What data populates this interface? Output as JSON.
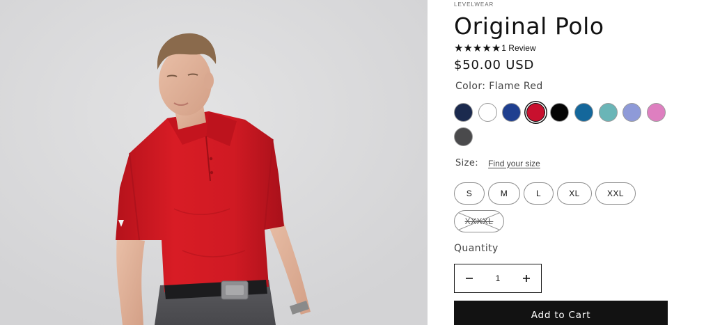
{
  "product": {
    "vendor": "LEVELWEAR",
    "title": "Original Polo",
    "rating": {
      "stars": 5,
      "star_glyph": "★",
      "review_count": "1 Review"
    },
    "price": "$50.00 USD",
    "image_alt": "Man wearing a red polo shirt with dark belt and grey pants"
  },
  "color": {
    "label": "Color: Flame Red",
    "selected": "Flame Red",
    "swatches": [
      {
        "color": "#1b2a4e",
        "selected": false
      },
      {
        "color": "#ffffff",
        "selected": false
      },
      {
        "color": "#1f3f8f",
        "selected": false
      },
      {
        "color": "#c8102e",
        "selected": true
      },
      {
        "color": "#050505",
        "selected": false
      },
      {
        "color": "#14679b",
        "selected": false
      },
      {
        "color": "#6ab5b7",
        "selected": false
      },
      {
        "color": "#8e9ad8",
        "selected": false
      },
      {
        "color": "#de7fc0",
        "selected": false
      },
      {
        "color": "#4a4a4c",
        "selected": false
      }
    ]
  },
  "size": {
    "label": "Size:",
    "guide_link": "Find your size",
    "options": [
      {
        "label": "S",
        "available": true
      },
      {
        "label": "M",
        "available": true
      },
      {
        "label": "L",
        "available": true
      },
      {
        "label": "XL",
        "available": true
      },
      {
        "label": "XXL",
        "available": true
      },
      {
        "label": "XXXXL",
        "available": false
      }
    ]
  },
  "quantity": {
    "label": "Quantity",
    "value": "1",
    "decrease_icon": "minus-icon",
    "increase_icon": "plus-icon"
  },
  "cart": {
    "add_label": "Add to Cart"
  },
  "colors": {
    "text": "#121212",
    "button_bg": "#121212",
    "button_text": "#ffffff",
    "shirt": "#d41a22"
  }
}
